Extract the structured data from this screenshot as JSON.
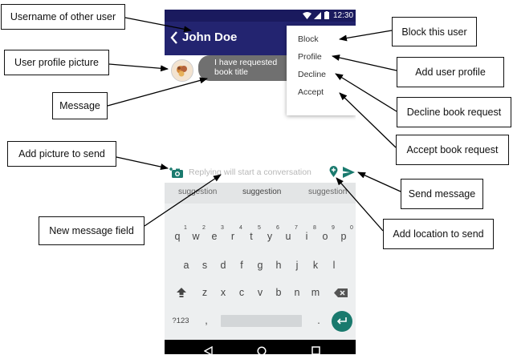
{
  "status": {
    "time": "12:30"
  },
  "chat": {
    "username": "John Doe",
    "message_line1": "I have requested",
    "message_line2": "book title"
  },
  "menu": {
    "items": [
      "Block",
      "Profile",
      "Decline",
      "Accept"
    ]
  },
  "input": {
    "placeholder": "Replying will start a conversation"
  },
  "suggestions": [
    "suggestion",
    "suggestion",
    "suggestion"
  ],
  "keyboard": {
    "row1": [
      "q",
      "w",
      "e",
      "r",
      "t",
      "y",
      "u",
      "i",
      "o",
      "p"
    ],
    "row1_digits": [
      "1",
      "2",
      "3",
      "4",
      "5",
      "6",
      "7",
      "8",
      "9",
      "0"
    ],
    "row2": [
      "a",
      "s",
      "d",
      "f",
      "g",
      "h",
      "j",
      "k",
      "l"
    ],
    "row3": [
      "z",
      "x",
      "c",
      "v",
      "b",
      "n",
      "m"
    ],
    "symbols": "?123",
    "comma": ",",
    "period": "."
  },
  "callouts": {
    "username": "Username of other user",
    "profile_picture": "User profile picture",
    "message": "Message",
    "add_picture": "Add picture to send",
    "new_message_field": "New message field",
    "block": "Block this user",
    "add_profile": "Add user profile",
    "decline": "Decline book request",
    "accept": "Accept book request",
    "send": "Send message",
    "add_location": "Add location to send"
  },
  "colors": {
    "appbar": "#232470",
    "accent": "#1a7a6e",
    "bubble": "#707070"
  }
}
